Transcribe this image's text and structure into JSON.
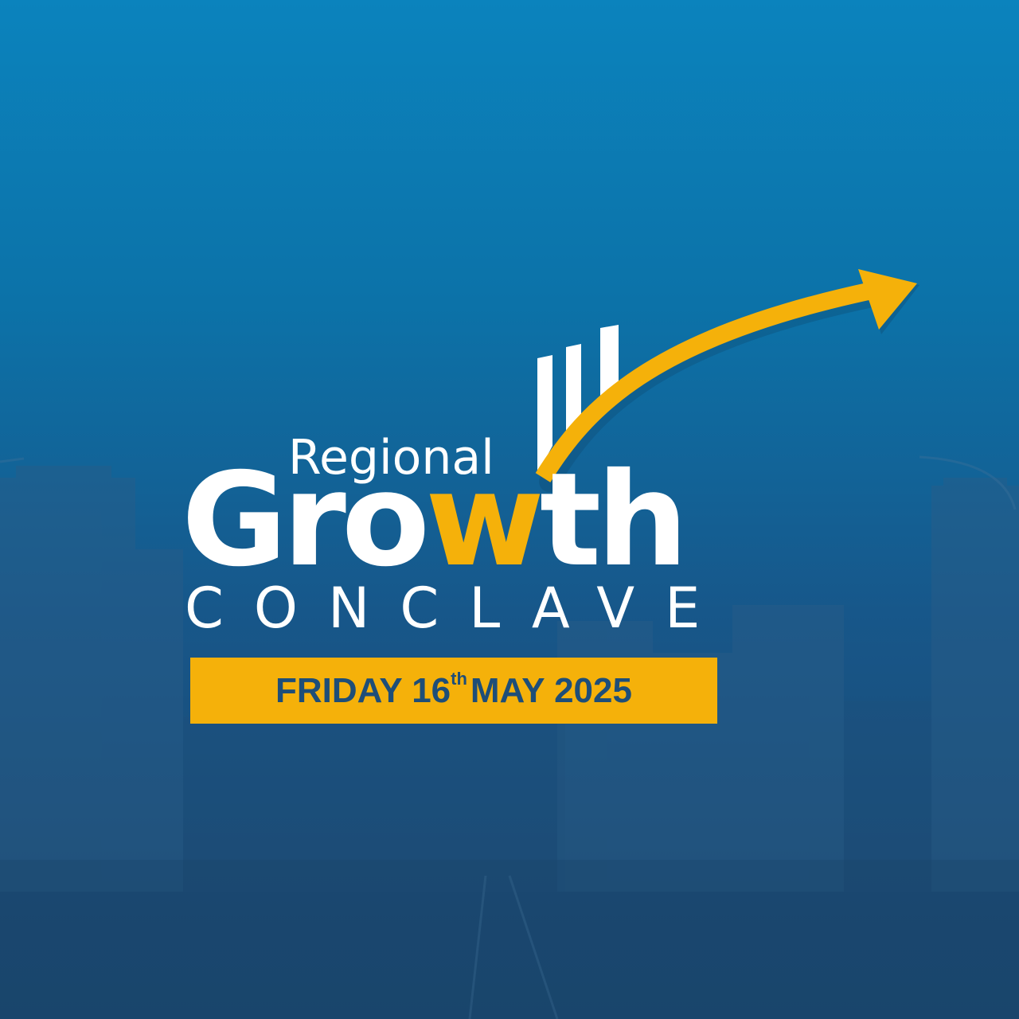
{
  "logo": {
    "line1": "Regional",
    "line2_part1": "Gro",
    "line2_w": "w",
    "line2_part2": "th",
    "line3": "CONCLAVE"
  },
  "date": {
    "day": "FRIDAY 16",
    "suffix": "th",
    "rest": "MAY 2025"
  },
  "colors": {
    "background": "#0c72a8",
    "accent": "#f5b10a",
    "text_dark": "#1e4e78",
    "logo_text": "#ffffff"
  },
  "icons": [
    "bar-chart-icon",
    "growth-arrow-icon"
  ]
}
